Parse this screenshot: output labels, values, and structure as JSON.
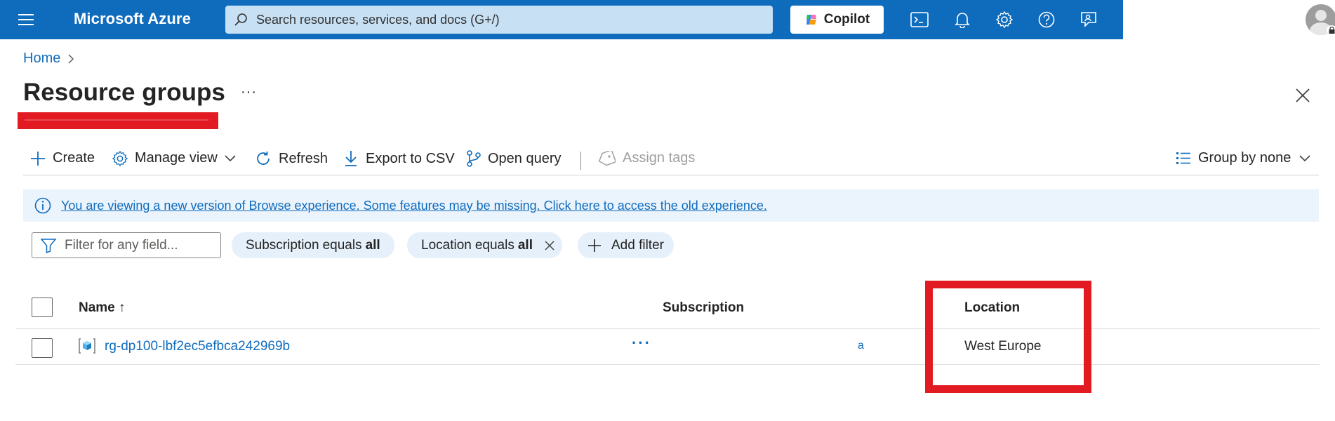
{
  "header": {
    "brand": "Microsoft Azure",
    "search_placeholder": "Search resources, services, and docs (G+/)",
    "copilot_label": "Copilot",
    "icons": [
      "menu-icon",
      "search-icon",
      "copilot-icon",
      "cloud-shell-icon",
      "bell-icon",
      "gear-icon",
      "help-icon",
      "feedback-icon",
      "avatar-icon"
    ]
  },
  "breadcrumb": {
    "home": "Home"
  },
  "page": {
    "title": "Resource groups",
    "more": "···"
  },
  "toolbar": {
    "create": "Create",
    "manage_view": "Manage view",
    "refresh": "Refresh",
    "export_csv": "Export to CSV",
    "open_query": "Open query",
    "assign_tags": "Assign tags",
    "group_by": "Group by none"
  },
  "banner": {
    "text": "You are viewing a new version of Browse experience. Some features may be missing. Click here to access the old experience."
  },
  "filters": {
    "placeholder": "Filter for any field...",
    "subscription": {
      "field": "Subscription",
      "op": "equals",
      "value": "all"
    },
    "location": {
      "field": "Location",
      "op": "equals",
      "value": "all"
    },
    "add_filter": "Add filter"
  },
  "table": {
    "columns": {
      "name": "Name ↑",
      "subscription": "Subscription",
      "location": "Location"
    },
    "rows": [
      {
        "name": "rg-dp100-lbf2ec5efbca242969b",
        "more": "···",
        "subscription_fragment": "a",
        "location": "West Europe"
      }
    ]
  },
  "colors": {
    "topbar": "#0f6cbd",
    "accent": "#0f6cbd",
    "highlight": "#e21b23",
    "banner_bg": "#ebf3fc",
    "pill_bg": "#e6f0fa"
  }
}
